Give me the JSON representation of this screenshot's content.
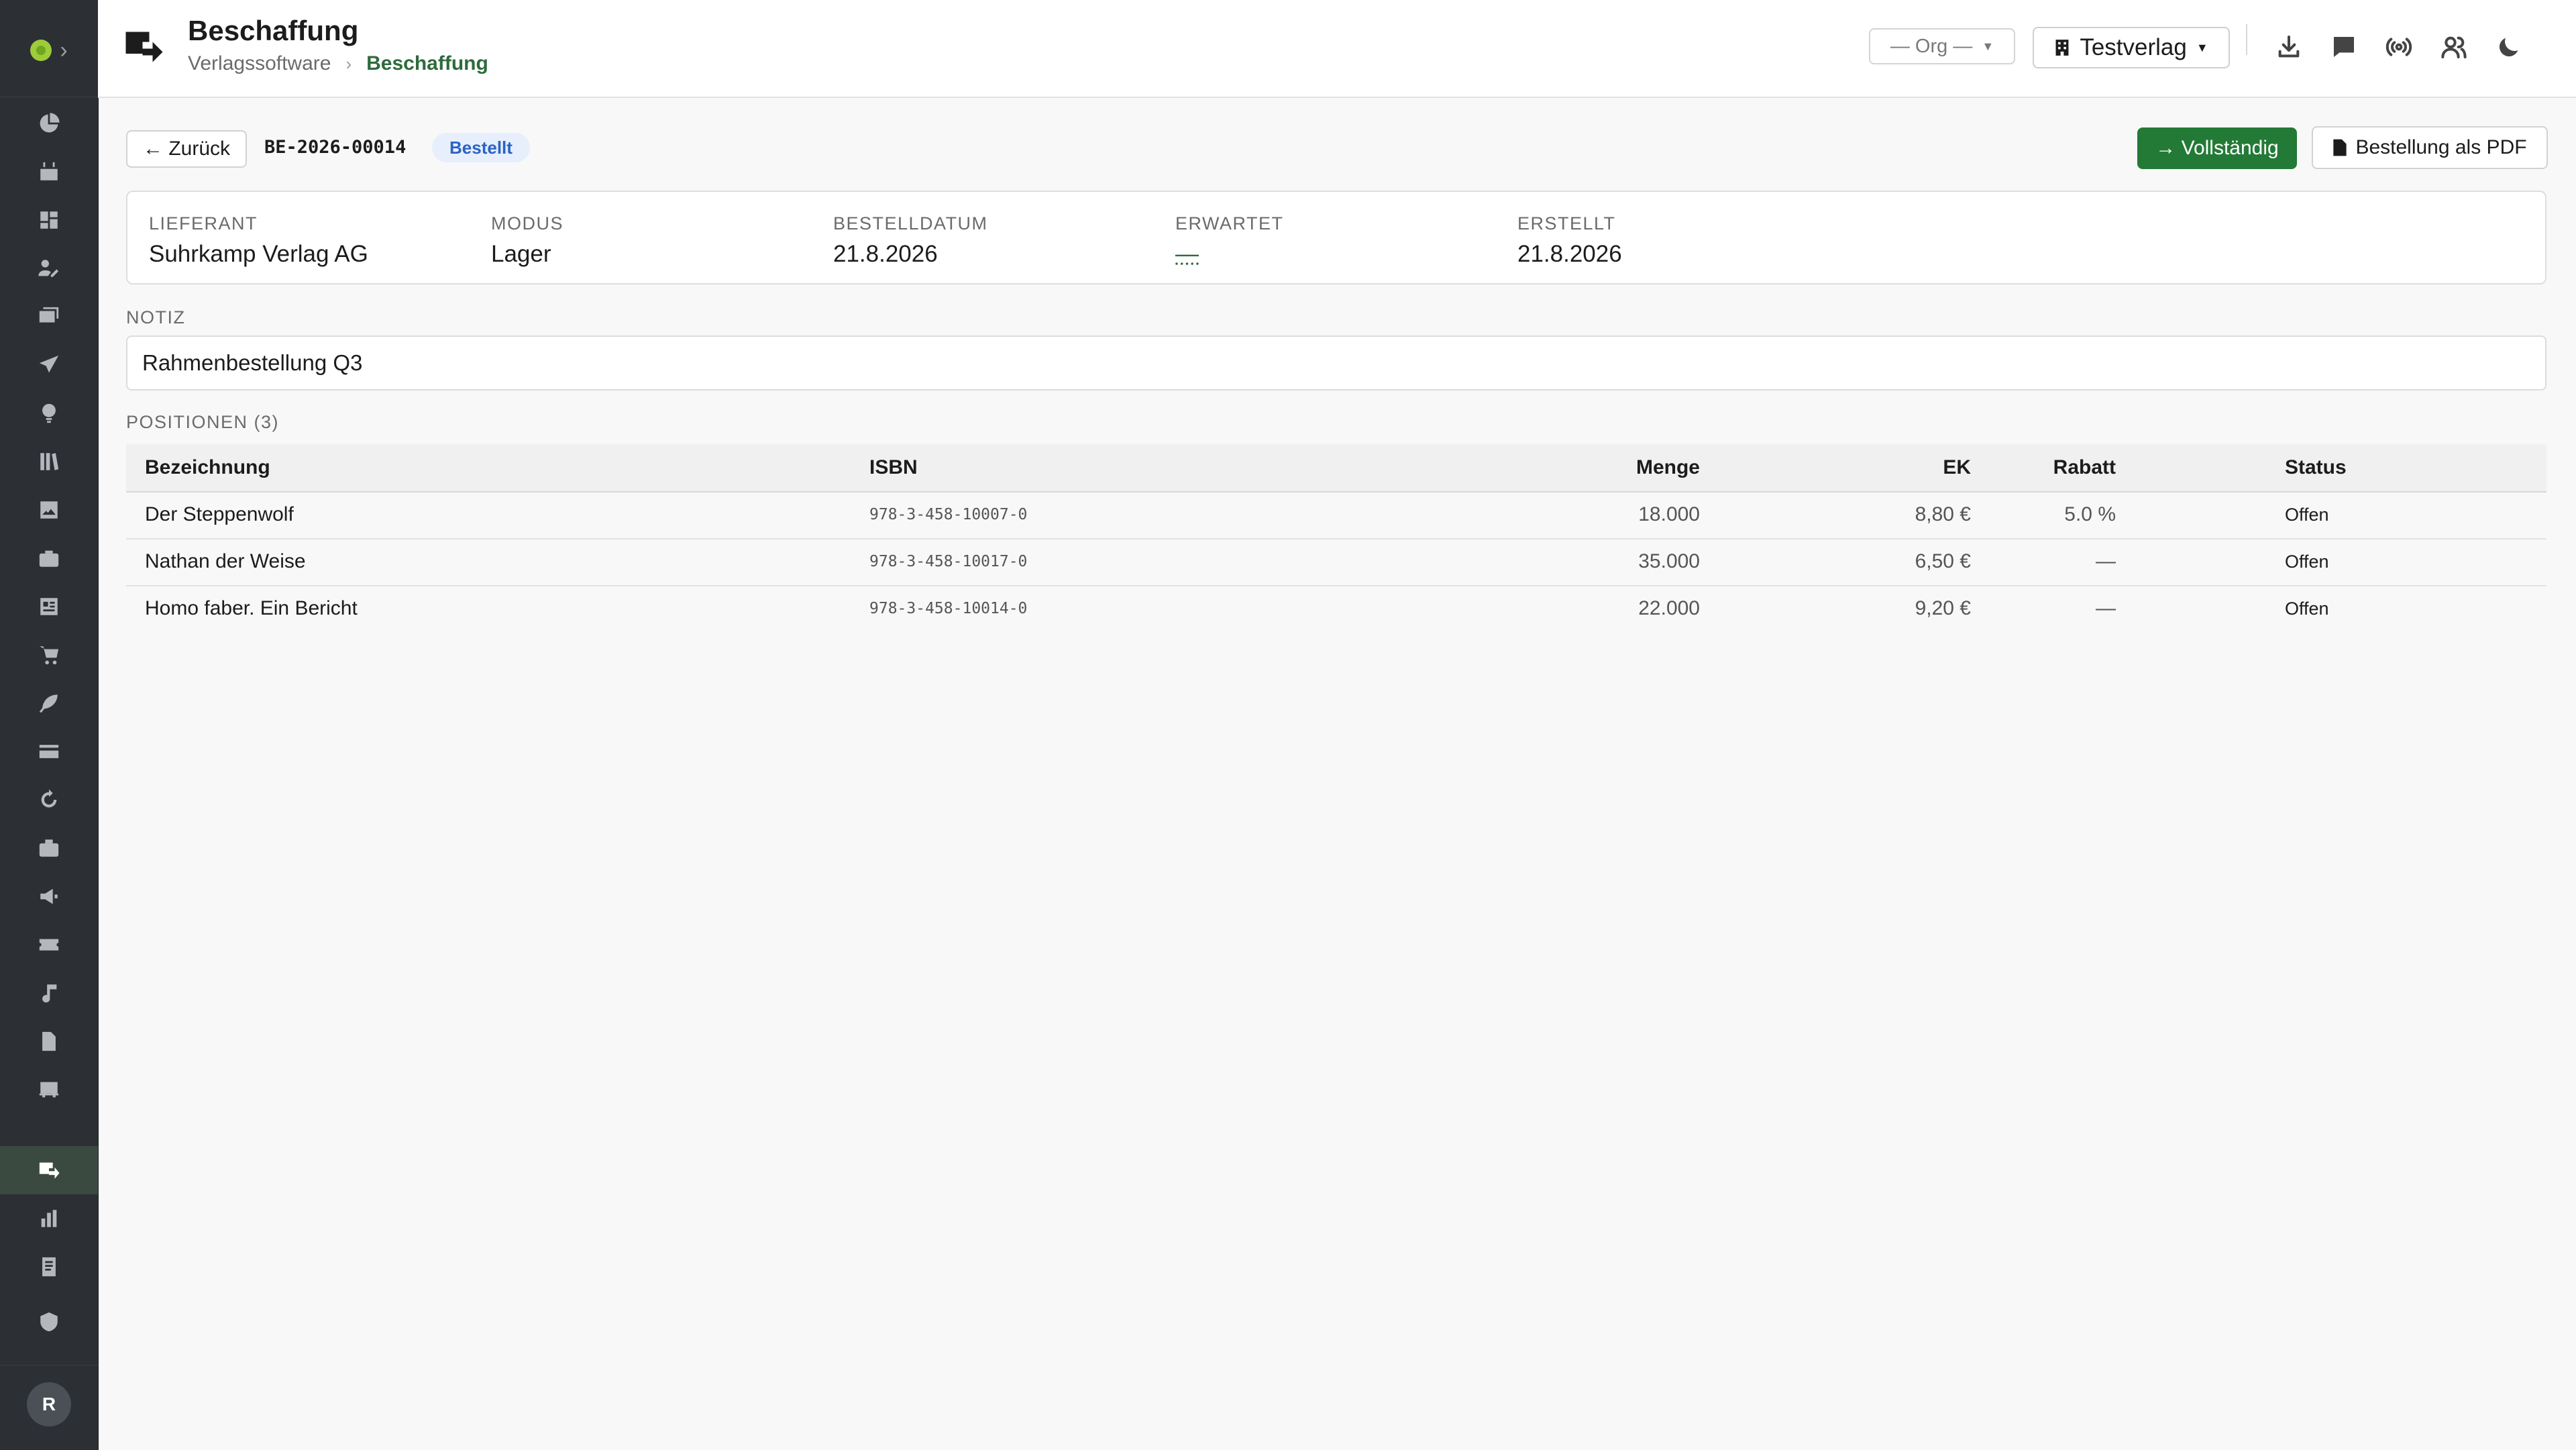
{
  "header": {
    "title": "Beschaffung",
    "breadcrumb": [
      "Verlagssoftware",
      "Beschaffung"
    ],
    "breadcrumb_sep": "›",
    "org_select": "— Org —",
    "publisher_select": "Testverlag",
    "icons": [
      "download-icon",
      "chat-icon",
      "broadcast-icon",
      "users-icon",
      "moon-icon"
    ]
  },
  "sidebar": {
    "items": [
      "dashboard-pie",
      "calendar",
      "widgets",
      "edit",
      "inbox",
      "send",
      "lightbulb",
      "library",
      "image",
      "briefcase",
      "panel",
      "cart",
      "feather",
      "card",
      "refresh",
      "toolbox",
      "megaphone",
      "ticket",
      "music",
      "document",
      "truck",
      "procurement",
      "bar-chart",
      "file",
      "shield"
    ],
    "active_item": "procurement",
    "avatar_initial": "R"
  },
  "toolbar": {
    "back_label": "← Zurück",
    "order_number": "BE-2026-00014",
    "status_badge": "Bestellt",
    "primary_action": "→ Vollständig",
    "pdf_action": "Bestellung als PDF"
  },
  "meta": {
    "supplier": {
      "label": "LIEFERANT",
      "value": "Suhrkamp Verlag AG"
    },
    "mode": {
      "label": "MODUS",
      "value": "Lager"
    },
    "order_date": {
      "label": "BESTELLDATUM",
      "value": "21.8.2026"
    },
    "expected": {
      "label": "ERWARTET",
      "value": "—"
    },
    "created": {
      "label": "ERSTELLT",
      "value": "21.8.2026"
    }
  },
  "note": {
    "label": "NOTIZ",
    "value": "Rahmenbestellung Q3"
  },
  "positions": {
    "label": "POSITIONEN (3)",
    "columns": [
      "Bezeichnung",
      "ISBN",
      "Menge",
      "EK",
      "Rabatt",
      "Status"
    ],
    "rows": [
      {
        "title": "Der Steppenwolf",
        "isbn": "978-3-458-10007-0",
        "qty": "18.000",
        "price": "8,80 €",
        "discount": "5.0 %",
        "status": "Offen"
      },
      {
        "title": "Nathan der Weise",
        "isbn": "978-3-458-10017-0",
        "qty": "35.000",
        "price": "6,50 €",
        "discount": "—",
        "status": "Offen"
      },
      {
        "title": "Homo faber. Ein Bericht",
        "isbn": "978-3-458-10014-0",
        "qty": "22.000",
        "price": "9,20 €",
        "discount": "—",
        "status": "Offen"
      }
    ]
  },
  "colors": {
    "accent": "#237a36",
    "sidebar": "#2c2f33",
    "badge_bg": "#e6effb",
    "badge_text": "#2b63c4"
  }
}
